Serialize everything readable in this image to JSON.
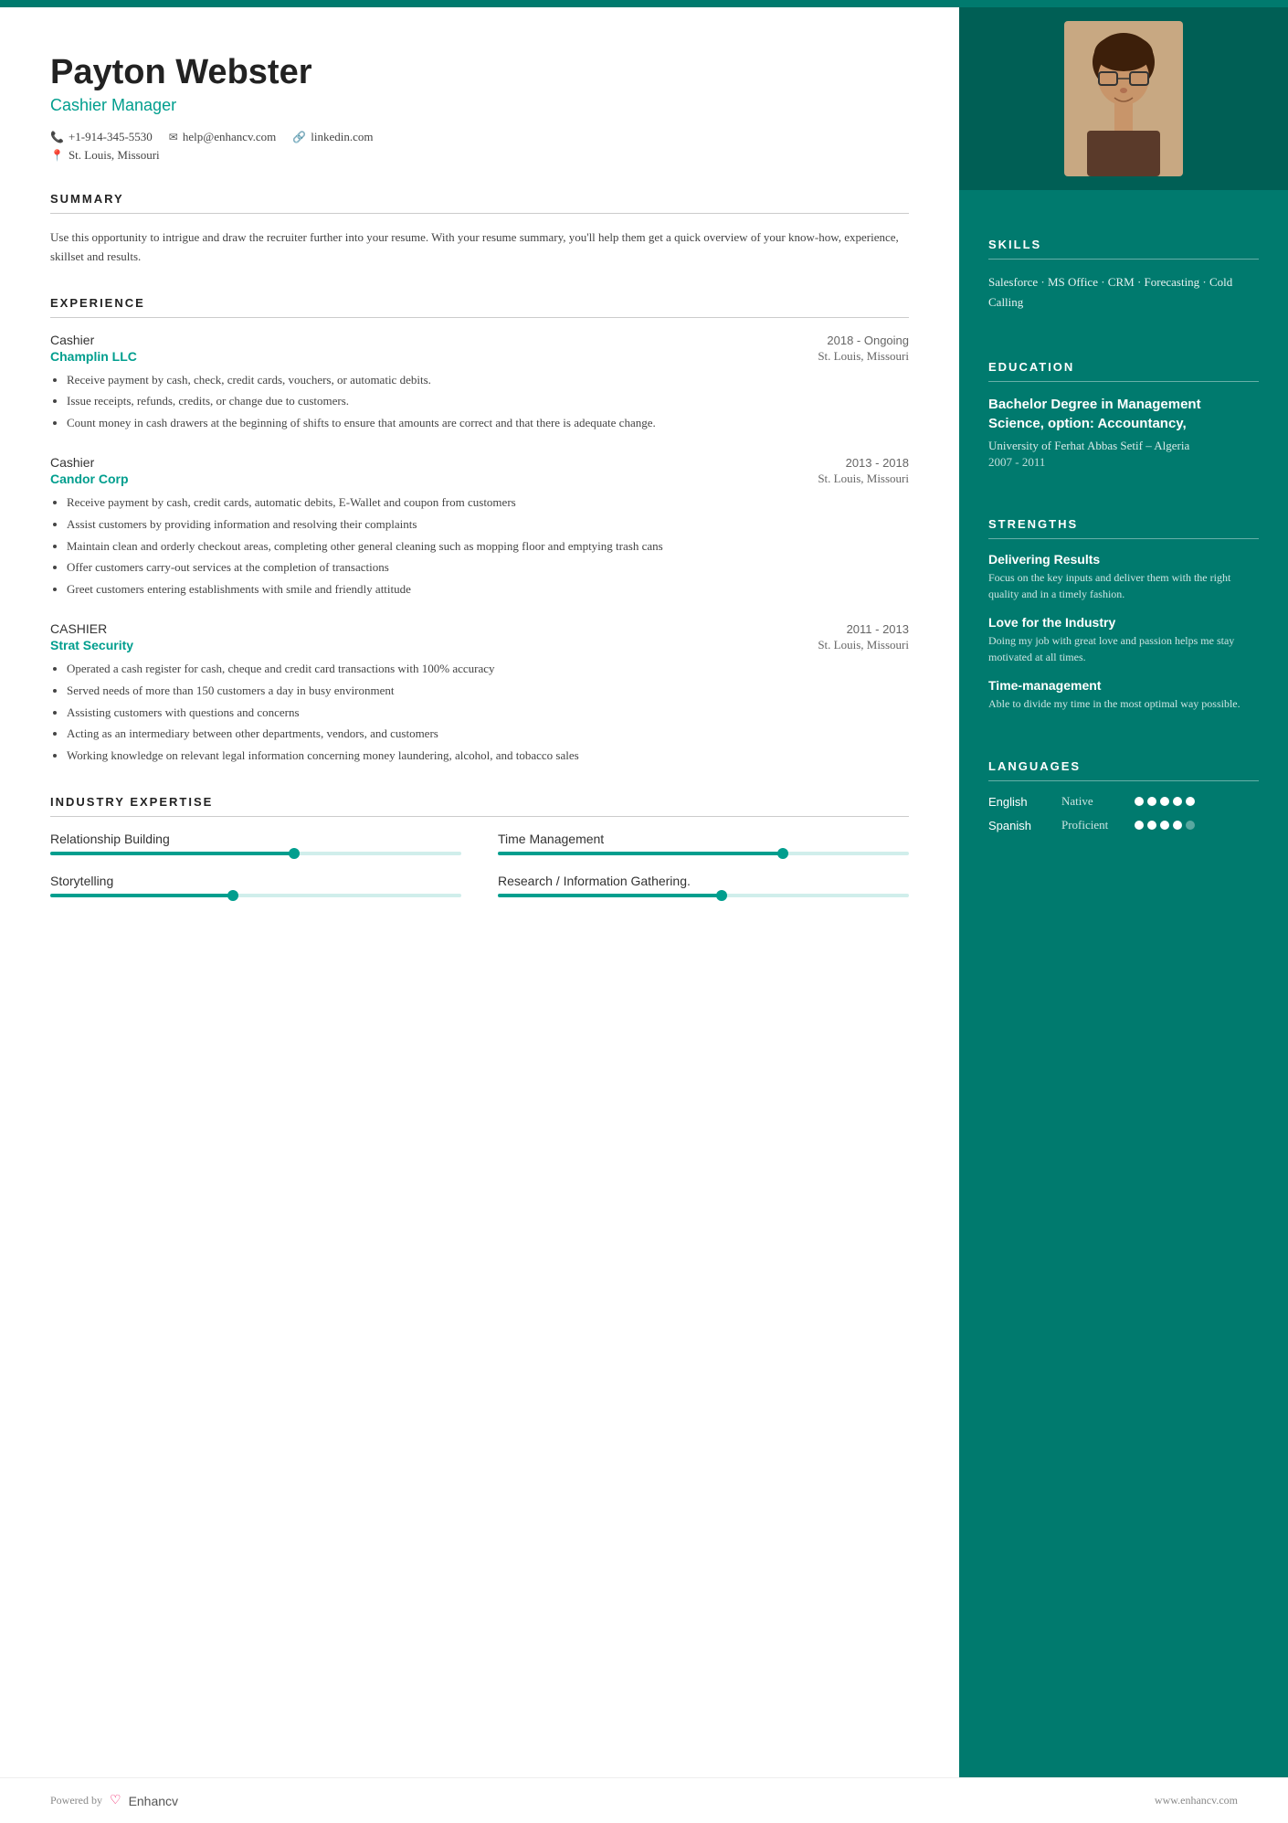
{
  "header": {
    "name": "Payton Webster",
    "title": "Cashier Manager",
    "phone": "+1-914-345-5530",
    "email": "help@enhancv.com",
    "website": "linkedin.com",
    "location": "St. Louis, Missouri"
  },
  "summary": {
    "section_title": "SUMMARY",
    "text": "Use this opportunity to intrigue and draw the recruiter further into your resume. With your resume summary, you'll help them get a quick overview of your know-how, experience, skillset and results."
  },
  "experience": {
    "section_title": "EXPERIENCE",
    "items": [
      {
        "role": "Cashier",
        "company": "Champlin LLC",
        "dates": "2018 - Ongoing",
        "location": "St. Louis, Missouri",
        "bullets": [
          "Receive payment by cash, check, credit cards, vouchers, or automatic debits.",
          "Issue receipts, refunds, credits, or change due to customers.",
          "Count money in cash drawers at the beginning of shifts to ensure that amounts are correct and that there is adequate change."
        ]
      },
      {
        "role": "Cashier",
        "company": "Candor Corp",
        "dates": "2013 - 2018",
        "location": "St. Louis, Missouri",
        "bullets": [
          "Receive payment by cash, credit cards, automatic debits, E-Wallet and coupon from customers",
          "Assist customers by providing information and resolving their complaints",
          "Maintain clean and orderly checkout areas, completing other general cleaning such as mopping floor and emptying trash cans",
          "Offer customers carry-out services at the completion of transactions",
          "Greet customers entering establishments with smile and friendly attitude"
        ]
      },
      {
        "role": "CASHIER",
        "company": "Strat Security",
        "dates": "2011 - 2013",
        "location": "St. Louis, Missouri",
        "bullets": [
          "Operated a cash register for cash, cheque and credit card transactions with 100% accuracy",
          "Served needs of more than 150 customers a day in busy environment",
          "Assisting customers with questions and concerns",
          "Acting as an intermediary between other departments, vendors, and customers",
          "Working knowledge on relevant legal information concerning money laundering, alcohol, and tobacco sales"
        ]
      }
    ]
  },
  "industry_expertise": {
    "section_title": "INDUSTRY EXPERTISE",
    "items": [
      {
        "name": "Relationship Building",
        "fill_pct": 60
      },
      {
        "name": "Time Management",
        "fill_pct": 70
      },
      {
        "name": "Storytelling",
        "fill_pct": 45
      },
      {
        "name": "Research / Information Gathering.",
        "fill_pct": 55
      }
    ]
  },
  "skills": {
    "section_title": "SKILLS",
    "text": "Salesforce · MS Office · CRM · Forecasting · Cold Calling"
  },
  "education": {
    "section_title": "EDUCATION",
    "degree": "Bachelor Degree in Management Science, option: Accountancy,",
    "school": "University of Ferhat Abbas Setif – Algeria",
    "years": "2007 - 2011"
  },
  "strengths": {
    "section_title": "STRENGTHS",
    "items": [
      {
        "name": "Delivering Results",
        "desc": "Focus on the key inputs and deliver them with the right quality and in a timely fashion."
      },
      {
        "name": "Love for the Industry",
        "desc": "Doing my job with great love and passion helps me stay motivated at all times."
      },
      {
        "name": "Time-management",
        "desc": "Able to divide my time in the most optimal way possible."
      }
    ]
  },
  "languages": {
    "section_title": "LANGUAGES",
    "items": [
      {
        "name": "English",
        "level": "Native",
        "filled": 5,
        "total": 5
      },
      {
        "name": "Spanish",
        "level": "Proficient",
        "filled": 4,
        "total": 5
      }
    ]
  },
  "footer": {
    "powered_by": "Powered by",
    "brand": "Enhancv",
    "website": "www.enhancv.com"
  }
}
